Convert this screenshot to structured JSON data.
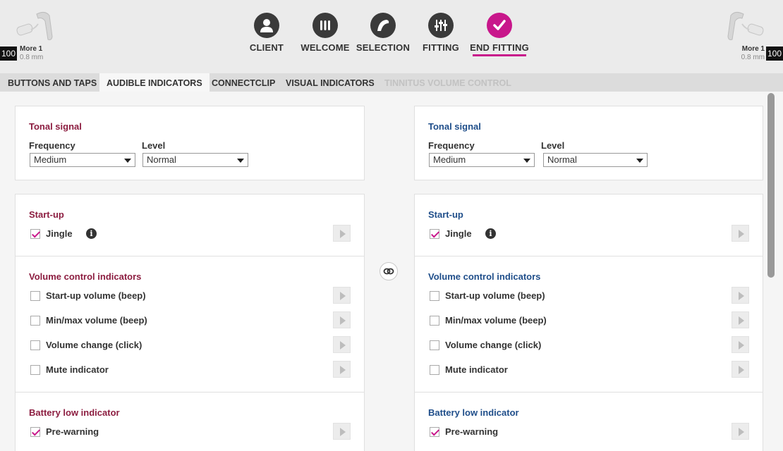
{
  "header": {
    "left_device": {
      "volume": "100",
      "name": "More 1",
      "size": "0.8 mm"
    },
    "right_device": {
      "volume": "100",
      "name": "More 1",
      "size": "0.8 mm"
    },
    "steps": [
      {
        "label": "CLIENT",
        "icon": "client-icon"
      },
      {
        "label": "WELCOME",
        "icon": "welcome-icon"
      },
      {
        "label": "SELECTION",
        "icon": "selection-icon"
      },
      {
        "label": "FITTING",
        "icon": "fitting-icon"
      },
      {
        "label": "END FITTING",
        "icon": "check-icon",
        "active": true
      }
    ],
    "accent_color": "#c8178b"
  },
  "tabs": [
    {
      "label": "BUTTONS AND TAPS"
    },
    {
      "label": "AUDIBLE INDICATORS",
      "active": true
    },
    {
      "label": "CONNECTCLIP"
    },
    {
      "label": "VISUAL INDICATORS"
    },
    {
      "label": "TINNITUS VOLUME CONTROL",
      "disabled": true
    }
  ],
  "left": {
    "title_color": "#8c1d40",
    "tonal": {
      "title": "Tonal signal",
      "frequency_label": "Frequency",
      "frequency_value": "Medium",
      "level_label": "Level",
      "level_value": "Normal"
    },
    "startup": {
      "title": "Start-up",
      "jingle": "Jingle",
      "jingle_checked": true
    },
    "volume": {
      "title": "Volume control indicators",
      "items": [
        "Start-up volume (beep)",
        "Min/max volume (beep)",
        "Volume change (click)",
        "Mute indicator"
      ]
    },
    "battery": {
      "title": "Battery low indicator",
      "prewarning": "Pre-warning",
      "prewarning_checked": true
    }
  },
  "right": {
    "title_color": "#1f4e8a",
    "tonal": {
      "title": "Tonal signal",
      "frequency_label": "Frequency",
      "frequency_value": "Medium",
      "level_label": "Level",
      "level_value": "Normal"
    },
    "startup": {
      "title": "Start-up",
      "jingle": "Jingle",
      "jingle_checked": true
    },
    "volume": {
      "title": "Volume control indicators",
      "items": [
        "Start-up volume (beep)",
        "Min/max volume (beep)",
        "Volume change (click)",
        "Mute indicator"
      ]
    },
    "battery": {
      "title": "Battery low indicator",
      "prewarning": "Pre-warning",
      "prewarning_checked": true
    }
  },
  "link_icon": "link-sides-icon",
  "info_glyph": "i"
}
